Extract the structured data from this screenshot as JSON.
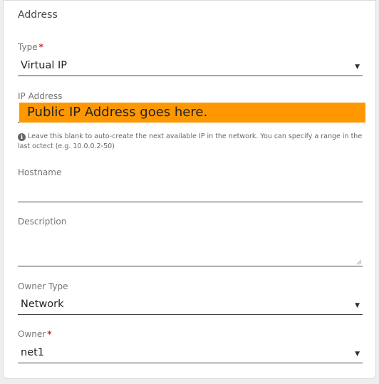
{
  "section": {
    "title": "Address"
  },
  "type_field": {
    "label": "Type",
    "required_mark": "*",
    "value": "Virtual IP",
    "caret": "▼"
  },
  "ip_field": {
    "label": "IP Address",
    "overlay_text": "Public IP Address goes here.",
    "help_icon": "i",
    "help_text": "Leave this blank to auto-create the next available IP in the network. You can specify a range in the last octect (e.g. 10.0.0.2-50)"
  },
  "hostname_field": {
    "label": "Hostname",
    "value": ""
  },
  "description_field": {
    "label": "Description",
    "value": ""
  },
  "owner_type_field": {
    "label": "Owner Type",
    "value": "Network",
    "caret": "▼"
  },
  "owner_field": {
    "label": "Owner",
    "required_mark": "*",
    "value": "net1",
    "caret": "▼"
  },
  "colors": {
    "highlight": "#ff9800",
    "required": "#c62828"
  }
}
